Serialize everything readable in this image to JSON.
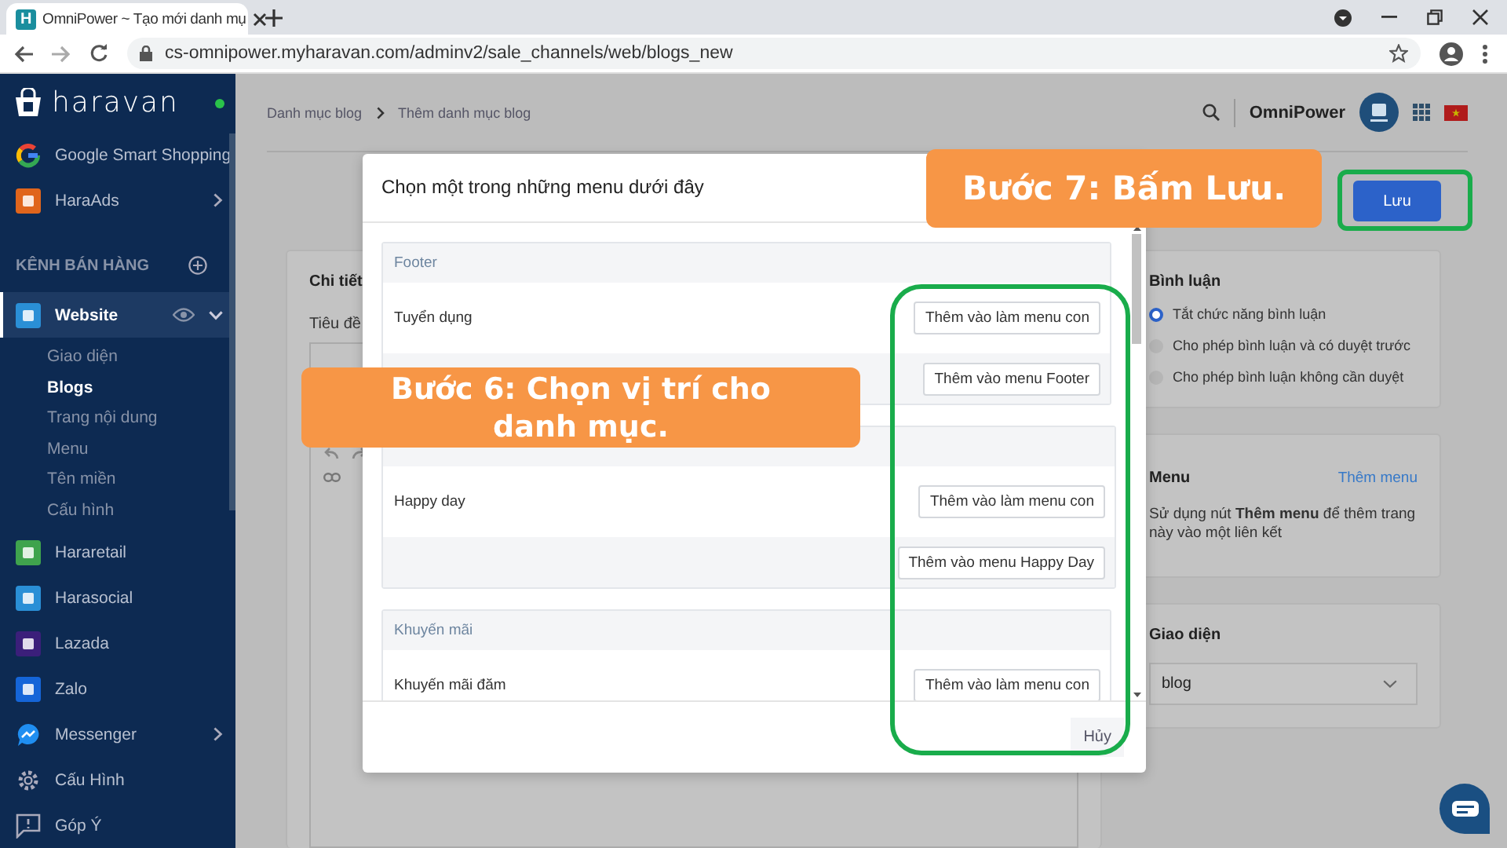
{
  "browser": {
    "tab": {
      "favicon_letter": "H",
      "title": "OmniPower ~ Tạo mới danh mụ"
    },
    "url": "cs-omnipower.myharavan.com/adminv2/sale_channels/web/blogs_new"
  },
  "sidebar": {
    "logo": "haravan",
    "items": [
      {
        "kind": "app",
        "label": "Google Smart Shopping",
        "expandable": false
      },
      {
        "kind": "app",
        "label": "HaraAds",
        "expandable": true
      },
      {
        "kind": "section",
        "label": "KÊNH BÁN HÀNG"
      },
      {
        "kind": "app",
        "label": "Website",
        "expandable": true,
        "selected": true,
        "children": [
          {
            "label": "Giao diện",
            "selected": false
          },
          {
            "label": "Blogs",
            "selected": true
          },
          {
            "label": "Trang nội dung",
            "selected": false
          },
          {
            "label": "Menu",
            "selected": false
          },
          {
            "label": "Tên miền",
            "selected": false
          },
          {
            "label": "Cấu hình",
            "selected": false
          }
        ]
      },
      {
        "kind": "app",
        "label": "Hararetail",
        "expandable": false
      },
      {
        "kind": "app",
        "label": "Harasocial",
        "expandable": false
      },
      {
        "kind": "app",
        "label": "Lazada",
        "expandable": false
      },
      {
        "kind": "app",
        "label": "Zalo",
        "expandable": false
      },
      {
        "kind": "app",
        "label": "Messenger",
        "expandable": true
      },
      {
        "kind": "tool",
        "label": "Cấu Hình"
      },
      {
        "kind": "tool",
        "label": "Góp Ý"
      }
    ]
  },
  "breadcrumb": [
    "Danh mục blog",
    "Thêm danh mục blog"
  ],
  "account": {
    "name": "OmniPower"
  },
  "save_button": "Lưu",
  "details": {
    "title": "Chi tiết",
    "field_label": "Tiêu đề"
  },
  "comments": {
    "title": "Bình luận",
    "options": [
      {
        "label": "Tắt chức năng bình luận",
        "selected": true
      },
      {
        "label": "Cho phép bình luận và có duyệt trước",
        "selected": false
      },
      {
        "label": "Cho phép bình luận không cần duyệt",
        "selected": false
      }
    ]
  },
  "menu_card": {
    "title": "Menu",
    "link": "Thêm menu",
    "note": "Sử dụng nút **Thêm menu** để thêm trang này vào một liên kết"
  },
  "theme_card": {
    "title": "Giao diện",
    "value": "blog"
  },
  "modal": {
    "title": "Chọn một trong những menu dưới đây",
    "groups": [
      {
        "header": "Footer",
        "rows": [
          {
            "label": "Tuyển dụng",
            "action": "Thêm vào làm menu con"
          },
          {
            "action": "Thêm vào menu Footer"
          }
        ]
      },
      {
        "rows": [
          {
            "label": "Happy day",
            "action": "Thêm vào làm menu con"
          },
          {
            "action": "Thêm vào menu Happy Day"
          }
        ]
      },
      {
        "header": "Khuyến mãi",
        "rows": [
          {
            "label": "Khuyến mãi đăm",
            "action": "Thêm vào làm menu con"
          }
        ]
      }
    ],
    "cancel": "Hủy"
  },
  "callouts": [
    {
      "text": "Bước 7: Bấm Lưu."
    },
    {
      "text": "Bước 6: Chọn vị trí cho danh mục."
    }
  ]
}
